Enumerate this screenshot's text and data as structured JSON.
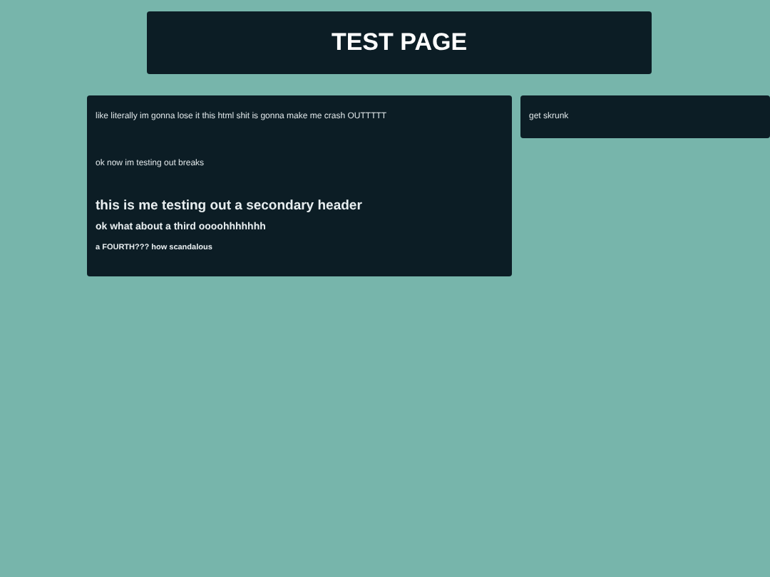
{
  "header": {
    "title": "TEST PAGE"
  },
  "main_card": {
    "blocks": [
      {
        "kind": "paragraph",
        "text": "like literally im gonna lose it this html shit is gonna make me crash OUTTTTT"
      },
      {
        "kind": "paragraph",
        "text": "ok now im testing out breaks"
      },
      {
        "kind": "h2",
        "text": "this is me testing out a secondary header"
      },
      {
        "kind": "h3",
        "text": "ok what about a third oooohhhhhhh"
      },
      {
        "kind": "h4",
        "text": "a FOURTH??? how scandalous"
      }
    ]
  },
  "side_card": {
    "text": "get skrunk"
  }
}
